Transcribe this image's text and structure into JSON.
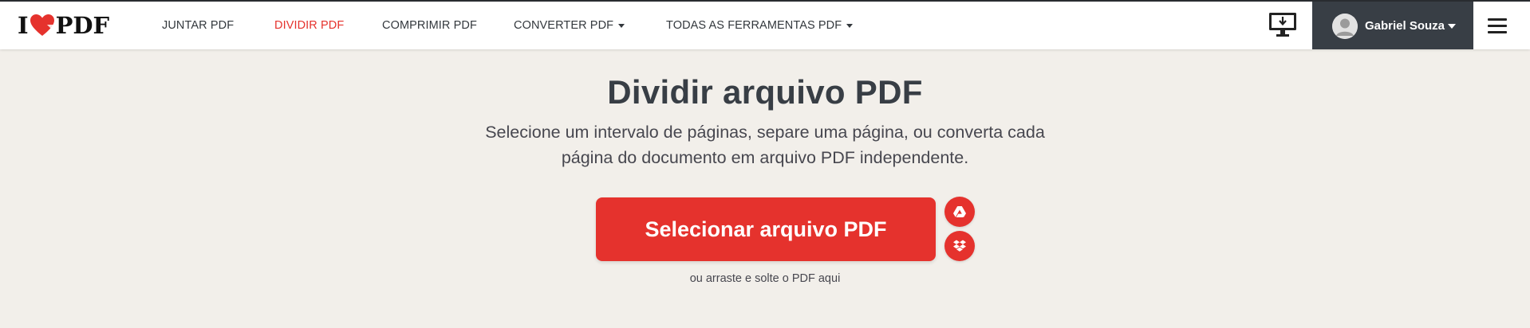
{
  "brand": {
    "logo_left": "I",
    "logo_right": "PDF",
    "accent_color": "#e5322d",
    "dark_color": "#383e45"
  },
  "nav": {
    "items": [
      {
        "label": "JUNTAR PDF",
        "active": false
      },
      {
        "label": "DIVIDIR PDF",
        "active": true
      },
      {
        "label": "COMPRIMIR PDF",
        "active": false
      },
      {
        "label": "CONVERTER PDF",
        "active": false,
        "has_dropdown": true
      },
      {
        "label": "TODAS AS FERRAMENTAS PDF",
        "active": false,
        "has_dropdown": true
      }
    ]
  },
  "header_right": {
    "desktop_icon": "desktop-download-icon",
    "user_name": "Gabriel Souza",
    "menu_icon": "hamburger-menu-icon"
  },
  "main": {
    "title": "Dividir arquivo PDF",
    "subtitle_line1": "Selecione um intervalo de páginas, separe uma página, ou converta cada",
    "subtitle_line2": "página do documento em arquivo PDF independente.",
    "select_button": "Selecionar arquivo PDF",
    "cloud_icons": [
      "google-drive-icon",
      "dropbox-icon"
    ],
    "drop_hint": "ou arraste e solte o PDF aqui"
  }
}
